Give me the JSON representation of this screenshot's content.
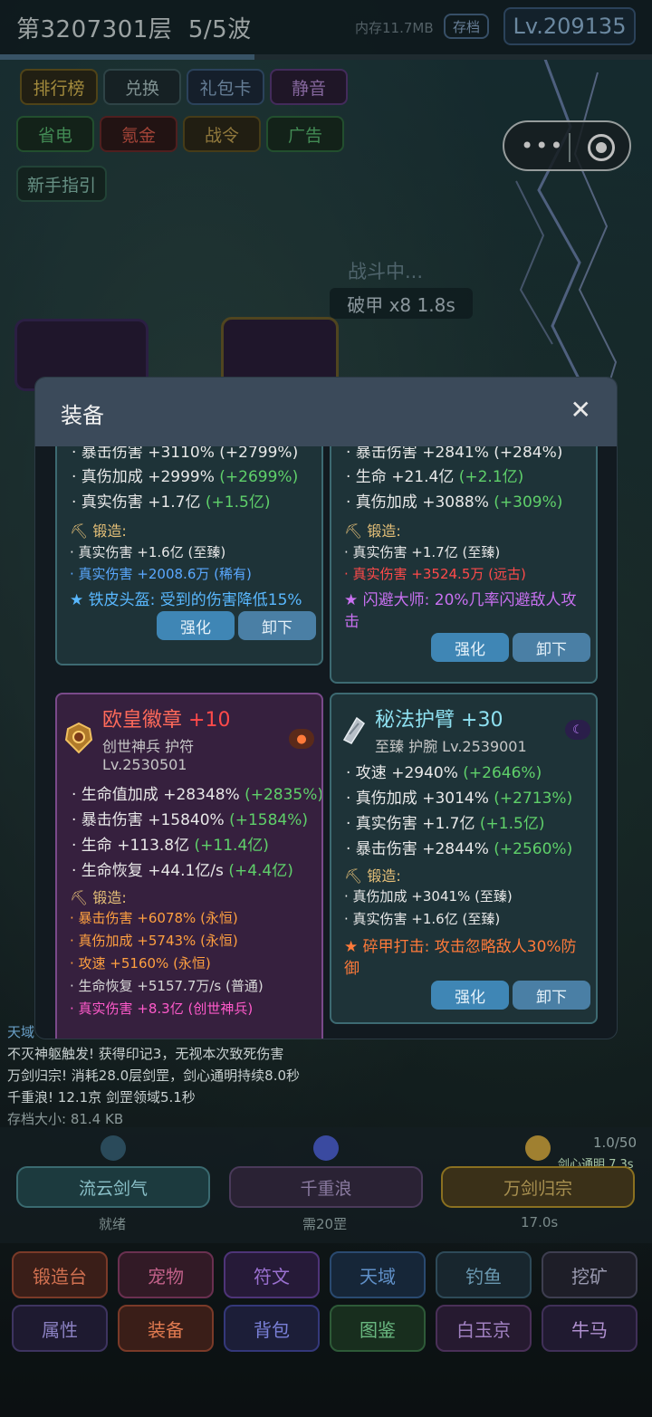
{
  "hud": {
    "floor": "第3207301层",
    "wave": "5/5波",
    "memory": "内存11.7MB",
    "save": "存档",
    "level": "Lv.209135",
    "wave_progress": 0.39
  },
  "top_buttons_row1": [
    "排行榜",
    "兑换",
    "礼包卡",
    "静音"
  ],
  "top_buttons_row2": [
    "省电",
    "氪金",
    "战令",
    "广告"
  ],
  "guide_button": "新手指引",
  "capsule": {
    "more": "•••"
  },
  "battle": {
    "status": "战斗中...",
    "break_armor": "破甲 x8 1.8s"
  },
  "modal": {
    "title": "装备",
    "close": "✕",
    "card_tl": {
      "cut_line": "· 暴击伤害 +3110% (+2799%)",
      "line1": "· 真伤加成 +2999%",
      "line1_inc": "(+2699%)",
      "line2": "· 真实伤害 +1.7亿",
      "line2_inc": "(+1.5亿)",
      "forge_title": "⛏ 锻造:",
      "forge1": "· 真实伤害 +1.6亿 (至臻)",
      "forge2": "· 真实伤害 +2008.6万 (稀有)",
      "skill": "★ 铁皮头盔: 受到的伤害降低15%",
      "btn_enhance": "强化",
      "btn_unequip": "卸下"
    },
    "card_tr": {
      "cut_line": "· 暴击伤害 +2841% (+284%)",
      "line1": "· 生命 +21.4亿",
      "line1_inc": "(+2.1亿)",
      "line2": "· 真伤加成 +3088%",
      "line2_inc": "(+309%)",
      "forge_title": "⛏ 锻造:",
      "forge1": "· 真实伤害 +1.7亿 (至臻)",
      "forge2": "· 真实伤害 +3524.5万 (远古)",
      "skill_line1": "★ 闪避大师: 20%几率闪避敌人攻",
      "skill_line2": "击",
      "btn_enhance": "强化",
      "btn_unequip": "卸下"
    },
    "card_bl": {
      "name": "欧皇徽章",
      "plus": "+10",
      "sub1": "创世神兵 护符",
      "sub2": "Lv.2530501",
      "line1": "· 生命值加成 +28348%",
      "line1_inc": "(+2835%)",
      "line2": "· 暴击伤害 +15840%",
      "line2_inc": "(+1584%)",
      "line3": "· 生命 +113.8亿",
      "line3_inc": "(+11.4亿)",
      "line4": "· 生命恢复 +44.1亿/s",
      "line4_inc": "(+4.4亿)",
      "forge_title": "⛏ 锻造:",
      "forge1": "· 暴击伤害 +6078% (永恒)",
      "forge2": "· 真伤加成 +5743% (永恒)",
      "forge3": "· 攻速 +5160% (永恒)",
      "forge4": "· 生命恢复 +5157.7万/s (普通)",
      "forge5": "· 真实伤害 +8.3亿 (创世神兵)"
    },
    "card_br": {
      "name": "秘法护臂",
      "plus": "+30",
      "sub1": "至臻 护腕  Lv.2539001",
      "line1": "· 攻速 +2940%",
      "line1_inc": "(+2646%)",
      "line2": "· 真伤加成 +3014%",
      "line2_inc": "(+2713%)",
      "line3": "· 真实伤害 +1.7亿",
      "line3_inc": "(+1.5亿)",
      "line4": "· 暴击伤害 +2844%",
      "line4_inc": "(+2560%)",
      "forge_title": "⛏ 锻造:",
      "forge1": "· 真伤加成 +3041% (至臻)",
      "forge2": "· 真实伤害 +1.6亿 (至臻)",
      "skill_line1": "★ 碎甲打击: 攻击忽略敌人30%防",
      "skill_line2": "御",
      "btn_enhance": "强化",
      "btn_unequip": "卸下"
    }
  },
  "log": [
    "天域",
    "不灭神躯触发! 获得印记3，无视本次致死伤害",
    "万剑归宗! 消耗28.0层剑罡，剑心通明持续8.0秒",
    "千重浪! 12.1京 剑罡领域5.1秒",
    "存档大小: 81.4 KB"
  ],
  "skills": {
    "timer_count": "1.0/50",
    "timer_effect": "剑心通明 7.3s",
    "s1": {
      "name": "流云剑气",
      "status": "就绪"
    },
    "s2": {
      "name": "千重浪",
      "status": "需20罡"
    },
    "s3": {
      "name": "万剑归宗",
      "status": "17.0s"
    }
  },
  "nav_row1": [
    "锻造台",
    "宠物",
    "符文",
    "天域",
    "钓鱼",
    "挖矿"
  ],
  "nav_row2": [
    "属性",
    "装备",
    "背包",
    "图鉴",
    "白玉京",
    "牛马"
  ],
  "colors": {
    "green_increment": "#5fd06a",
    "forge_gold": "#e6c078",
    "skill_blue": "#59b8ff",
    "skill_purple": "#c870f0",
    "skill_orange": "#ff7a3a",
    "rare_blue": "#5aa8ff",
    "ancient_red": "#ff4a4a",
    "eternal_orange": "#ffa040",
    "genesis_pink": "#ff5acb"
  }
}
